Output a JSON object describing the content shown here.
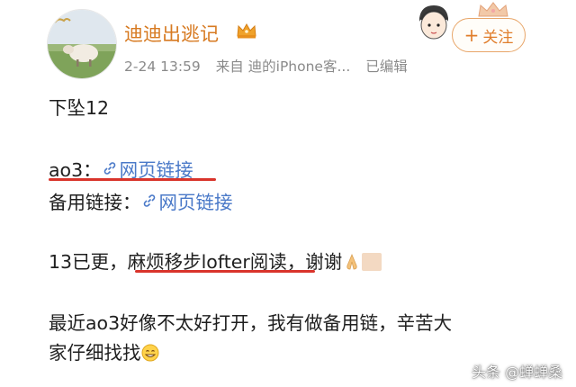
{
  "post": {
    "username": "迪迪出逃记",
    "time": "2-24 13:59",
    "source": "来自 迪的iPhone客...",
    "edited": "已编辑",
    "follow_label": "关注",
    "follow_plus": "+",
    "line1": "下坠12",
    "ao3_prefix": "ao3：",
    "link_label_1": "网页链接",
    "backup_prefix": "备用链接：",
    "link_label_2": "网页链接",
    "line_update_a": "13已更，",
    "line_update_b": "麻烦移步lofter阅读",
    "line_update_c": "，谢谢",
    "line_last_1": "最近ao3好像不太好打开，我有做备用链，辛苦大",
    "line_last_2": "家仔细找找"
  },
  "watermark": "头条 @蝉蝉桑",
  "colors": {
    "username": "#d77a21",
    "link": "#4a79c8",
    "underline": "#d9342b",
    "meta": "#8a8a8a"
  },
  "icons": {
    "avatar": "sheep-avatar",
    "verified": "crown-icon",
    "link": "link-icon",
    "emoji1": "pray-emoji",
    "emoji2": "skin-tone-emoji",
    "emoji3": "smile-emoji"
  }
}
